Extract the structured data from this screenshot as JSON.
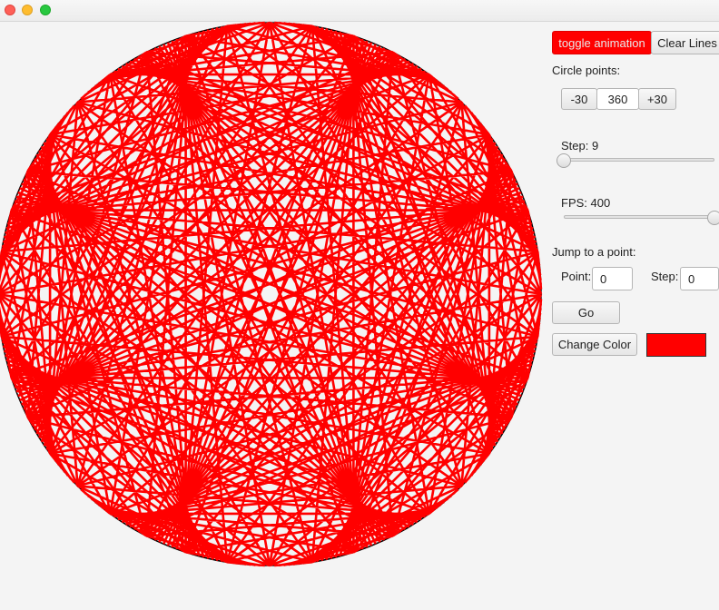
{
  "window": {
    "controls": [
      "close",
      "minimize",
      "maximize"
    ]
  },
  "canvas": {
    "circle_points": 360,
    "step": 9,
    "line_color": "#ff0000",
    "circle_outline_color": "#000000"
  },
  "controls": {
    "toggle_animation_label": "toggle animation",
    "clear_lines_label": "Clear Lines",
    "circle_points_label": "Circle points:",
    "minus_label": "-30",
    "points_value": "360",
    "plus_label": "+30",
    "step_label": "Step: 9",
    "step_slider_fraction": 0.0,
    "fps_label": "FPS: 400",
    "fps_slider_fraction": 1.0,
    "jump_label": "Jump to a point:",
    "point_label": "Point:",
    "point_value": "0",
    "jump_step_label": "Step:",
    "jump_step_value": "0",
    "go_label": "Go",
    "change_color_label": "Change Color",
    "accent_color": "#ff0000"
  }
}
